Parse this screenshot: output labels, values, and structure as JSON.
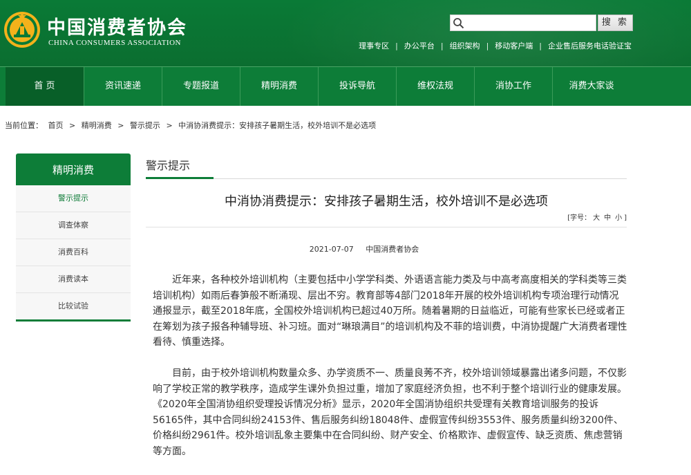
{
  "site": {
    "title": "中国消费者协会",
    "subtitle": "CHINA CONSUMERS ASSOCIATION",
    "brand_green": "#0d7d38",
    "logo_icon": "consumer-association-emblem"
  },
  "search": {
    "placeholder": "",
    "button_label": "搜 索"
  },
  "top_links": [
    "理事专区",
    "办公平台",
    "组织架构",
    "移动客户端",
    "企业售后服务电话验证宝"
  ],
  "nav": {
    "items": [
      "首 页",
      "资讯速递",
      "专题报道",
      "精明消费",
      "投诉导航",
      "维权法规",
      "消协工作",
      "消费大家谈"
    ],
    "active_index": 0
  },
  "breadcrumb": {
    "prefix": "当前位置：",
    "items": [
      "首页",
      "精明消费",
      "警示提示",
      "中消协消费提示：安排孩子暑期生活，校外培训不是必选项"
    ],
    "separator": ">"
  },
  "sidebar": {
    "title": "精明消费",
    "items": [
      "警示提示",
      "调查体察",
      "消费百科",
      "消费读本",
      "比较试验"
    ],
    "active_index": 0
  },
  "section": {
    "title": "警示提示"
  },
  "article": {
    "title": "中消协消费提示：安排孩子暑期生活，校外培训不是必选项",
    "font_size_label": "[字号：",
    "font_sizes": [
      "大",
      "中",
      "小"
    ],
    "font_size_suffix": "]",
    "date": "2021-07-07",
    "source": "中国消费者协会",
    "paragraphs": [
      "近年来，各种校外培训机构（主要包括中小学学科类、外语语言能力类及与中高考高度相关的学科类等三类培训机构）如雨后春笋般不断涌现、层出不穷。教育部等4部门2018年开展的校外培训机构专项治理行动情况通报显示，截至2018年底，全国校外培训机构已超过40万所。随着暑期的日益临近，可能有些家长已经或者正在筹划为孩子报各种辅导班、补习班。面对“琳琅满目”的培训机构及不菲的培训费，中消协提醒广大消费者理性看待、慎重选择。",
      "目前，由于校外培训机构数量众多、办学资质不一、质量良莠不齐，校外培训领域暴露出诸多问题，不仅影响了学校正常的教学秩序，造成学生课外负担过重，增加了家庭经济负担，也不利于整个培训行业的健康发展。《2020年全国消协组织受理投诉情况分析》显示，2020年全国消协组织共受理有关教育培训服务的投诉56165件，其中合同纠纷24153件、售后服务纠纷18048件、虚假宣传纠纷3553件、服务质量纠纷3200件、价格纠纷2961件。校外培训乱象主要集中在合同纠纷、财产安全、价格欺诈、虚假宣传、缺乏资质、焦虑营销等方面。"
    ]
  }
}
